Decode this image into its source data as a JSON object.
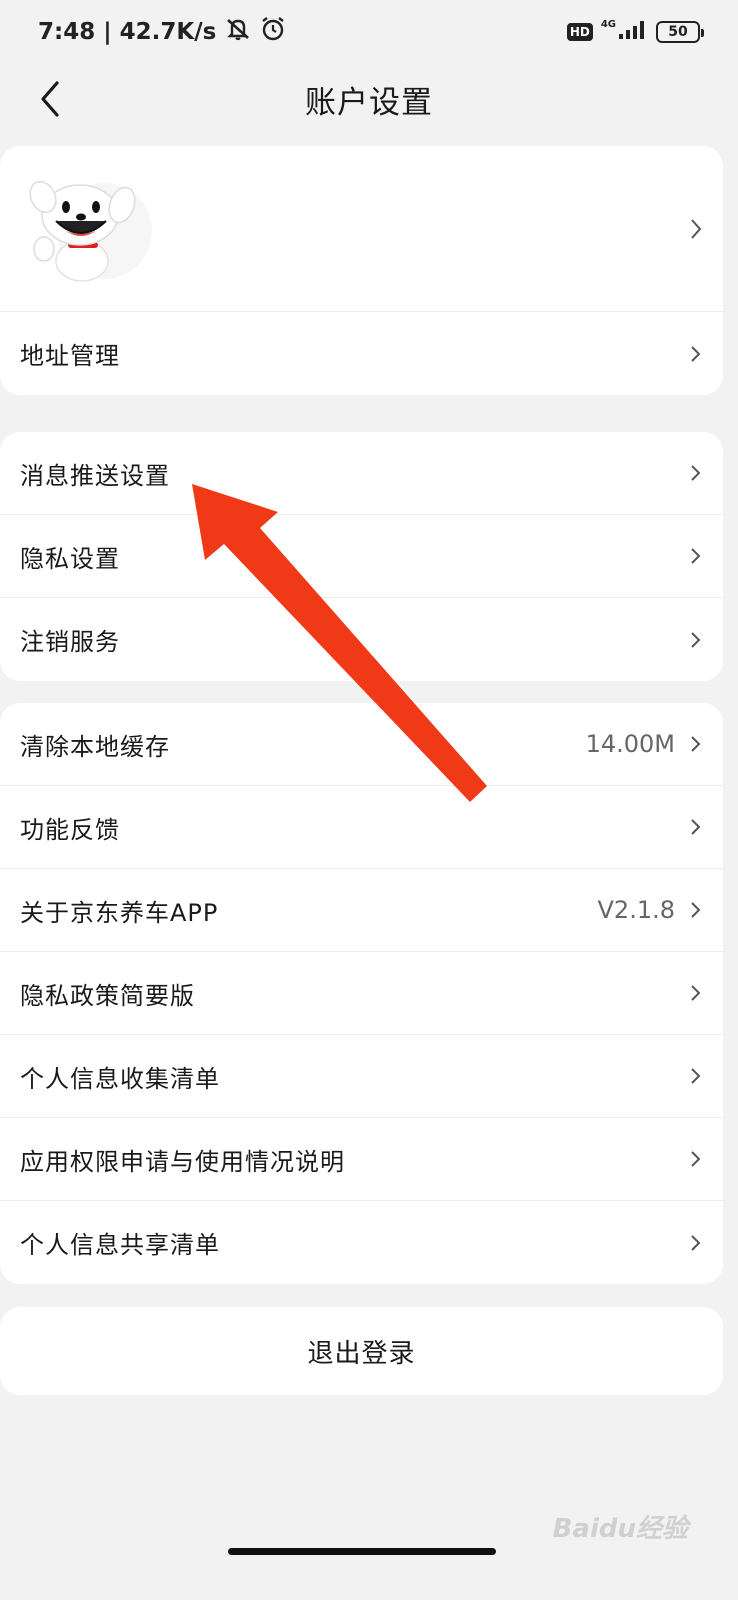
{
  "status_bar": {
    "time_speed": "7:48 | 42.7K/s",
    "hd": "HD",
    "network": "4G",
    "battery": "50"
  },
  "header": {
    "title": "账户设置"
  },
  "section1": {
    "address_label": "地址管理"
  },
  "section2": {
    "items": [
      {
        "label": "消息推送设置"
      },
      {
        "label": "隐私设置"
      },
      {
        "label": "注销服务"
      }
    ]
  },
  "section3": {
    "items": [
      {
        "label": "清除本地缓存",
        "value": "14.00M"
      },
      {
        "label": "功能反馈"
      },
      {
        "label": "关于京东养车APP",
        "value": "V2.1.8"
      },
      {
        "label": "隐私政策简要版"
      },
      {
        "label": "个人信息收集清单"
      },
      {
        "label": "应用权限申请与使用情况说明"
      },
      {
        "label": "个人信息共享清单"
      }
    ]
  },
  "logout_label": "退出登录",
  "watermark": "Baidu经验",
  "colors": {
    "background": "#f2f2f2",
    "card": "#ffffff",
    "annotation_arrow": "#f03a17"
  }
}
